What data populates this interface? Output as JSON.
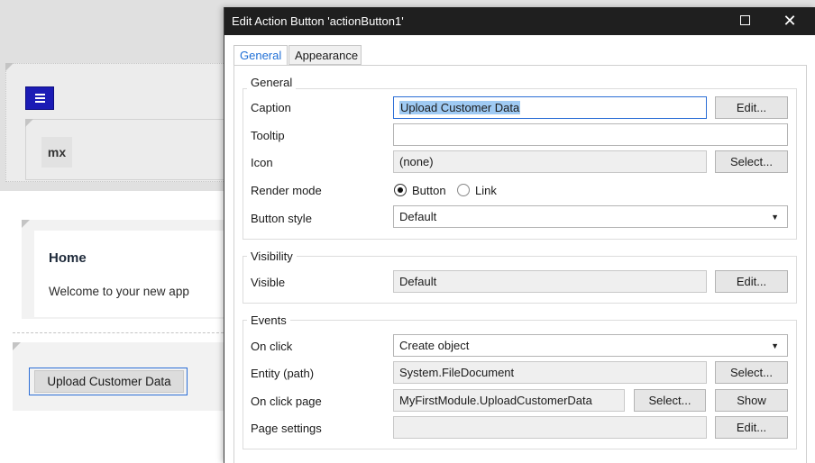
{
  "background": {
    "logo_text": "mx",
    "home_title": "Home",
    "home_subtitle": "Welcome to your new app",
    "upload_button_label": "Upload Customer Data"
  },
  "dialog": {
    "title": "Edit Action Button 'actionButton1'",
    "tabs": [
      {
        "label": "General",
        "active": true
      },
      {
        "label": "Appearance",
        "active": false
      }
    ],
    "general": {
      "group_label": "General",
      "caption_label": "Caption",
      "caption_value": "Upload Customer Data",
      "caption_button": "Edit...",
      "tooltip_label": "Tooltip",
      "tooltip_value": "",
      "icon_label": "Icon",
      "icon_value": "(none)",
      "icon_button": "Select...",
      "render_mode_label": "Render mode",
      "render_options": [
        "Button",
        "Link"
      ],
      "render_selected": "Button",
      "button_style_label": "Button style",
      "button_style_value": "Default"
    },
    "visibility": {
      "group_label": "Visibility",
      "visible_label": "Visible",
      "visible_value": "Default",
      "visible_button": "Edit..."
    },
    "events": {
      "group_label": "Events",
      "on_click_label": "On click",
      "on_click_value": "Create object",
      "entity_label": "Entity (path)",
      "entity_value": "System.FileDocument",
      "entity_button": "Select...",
      "on_click_page_label": "On click page",
      "on_click_page_value": "MyFirstModule.UploadCustomerData",
      "on_click_page_select": "Select...",
      "on_click_page_show": "Show",
      "page_settings_label": "Page settings",
      "page_settings_value": "",
      "page_settings_button": "Edit..."
    }
  },
  "colors": {
    "accent": "#1f6fd6",
    "title_bar": "#1f1f1f",
    "menu_button": "#1b1bb5",
    "selection": "#9fcaf3"
  }
}
